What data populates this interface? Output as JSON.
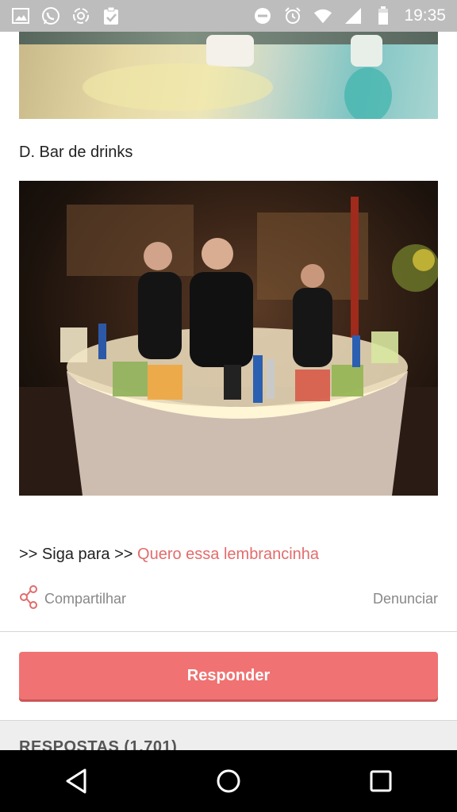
{
  "status_bar": {
    "time": "19:35",
    "left_icons": [
      "gallery-icon",
      "whatsapp-icon",
      "sync-app-icon",
      "clipboard-check-icon"
    ],
    "right_icons": [
      "do-not-disturb-icon",
      "alarm-icon",
      "wifi-icon",
      "signal-icon",
      "battery-icon"
    ]
  },
  "post": {
    "section_label": "D. Bar de drinks",
    "link_prefix": ">> Siga para >>",
    "link_text": "Quero essa lembrancinha",
    "share_label": "Compartilhar",
    "report_label": "Denunciar"
  },
  "reply_button_label": "Responder",
  "answers_label": "RESPOSTAS (1.701)",
  "nav_bar": [
    "back-icon",
    "home-icon",
    "recents-icon"
  ],
  "colors": {
    "accent": "#e26c6c",
    "button": "#f07272",
    "status_bar": "#bdbdbd"
  }
}
